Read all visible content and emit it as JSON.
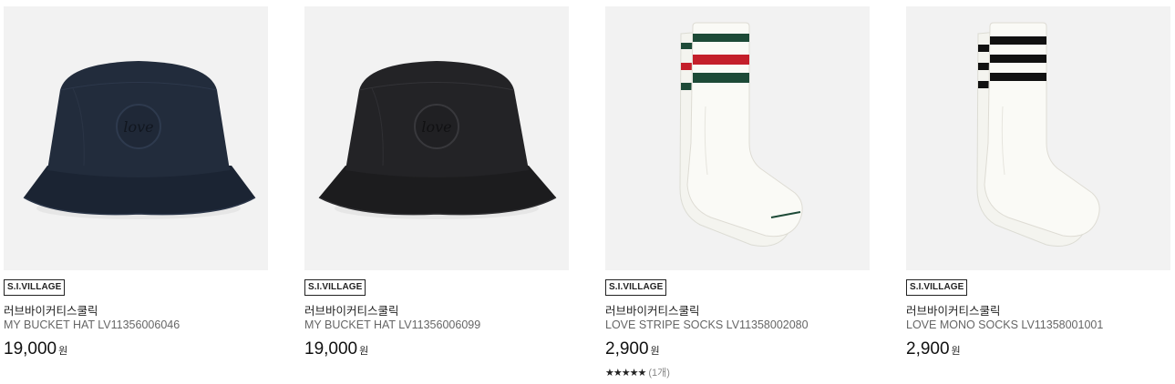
{
  "currency": "원",
  "products": [
    {
      "badge": "S.I.VILLAGE",
      "brand": "러브바이커티스쿨릭",
      "name": "MY BUCKET HAT LV11356006046",
      "price": "19,000",
      "image_icon": "navy-bucket-hat-icon"
    },
    {
      "badge": "S.I.VILLAGE",
      "brand": "러브바이커티스쿨릭",
      "name": "MY BUCKET HAT LV11356006099",
      "price": "19,000",
      "image_icon": "black-bucket-hat-icon"
    },
    {
      "badge": "S.I.VILLAGE",
      "brand": "러브바이커티스쿨릭",
      "name": "LOVE STRIPE SOCKS LV11358002080",
      "price": "2,900",
      "rating_stars": "★★★★★",
      "rating_count": "(1개)",
      "rating_value": 5,
      "image_icon": "striped-socks-icon"
    },
    {
      "badge": "S.I.VILLAGE",
      "brand": "러브바이커티스쿨릭",
      "name": "LOVE MONO SOCKS LV11358001001",
      "price": "2,900",
      "image_icon": "mono-socks-icon"
    }
  ],
  "colors": {
    "thumb_bg": "#f2f2f2",
    "hat_navy": "#1b2433",
    "hat_black": "#1c1c1e",
    "stripe_green": "#1d4a37",
    "stripe_red": "#c41f2a",
    "stripe_black": "#111111"
  }
}
